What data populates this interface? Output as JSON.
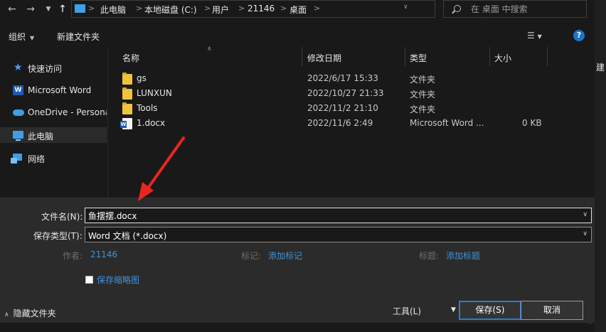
{
  "address": {
    "crumbs": [
      "此电脑",
      "本地磁盘 (C:)",
      "用户",
      "21146",
      "桌面"
    ],
    "search_placeholder": "在 桌面 中搜索"
  },
  "toolbar": {
    "organize": "组织",
    "new_folder": "新建文件夹",
    "help": "?"
  },
  "nav": {
    "items": [
      {
        "label": "快速访问",
        "icon": "star-icon"
      },
      {
        "label": "Microsoft Word",
        "icon": "word-icon"
      },
      {
        "label": "OneDrive - Persona",
        "icon": "cloud-icon"
      },
      {
        "label": "此电脑",
        "icon": "computer-icon",
        "selected": true
      },
      {
        "label": "网络",
        "icon": "network-icon"
      }
    ]
  },
  "files": {
    "columns": [
      "名称",
      "修改日期",
      "类型",
      "大小"
    ],
    "rows": [
      {
        "name": "gs",
        "date": "2022/6/17 15:33",
        "type": "文件夹",
        "size": "",
        "icon": "folder-icon"
      },
      {
        "name": "LUNXUN",
        "date": "2022/10/27 21:33",
        "type": "文件夹",
        "size": "",
        "icon": "folder-icon"
      },
      {
        "name": "Tools",
        "date": "2022/11/2 21:10",
        "type": "文件夹",
        "size": "",
        "icon": "folder-icon"
      },
      {
        "name": "1.docx",
        "date": "2022/11/6 2:49",
        "type": "Microsoft Word ...",
        "size": "0 KB",
        "icon": "word-doc-icon"
      }
    ]
  },
  "save": {
    "filename_label": "文件名(N):",
    "filename_value": "鱼摆摆.docx",
    "filetype_label": "保存类型(T):",
    "filetype_value": "Word 文档 (*.docx)",
    "author_label": "作者:",
    "author_value": "21146",
    "tags_label": "标记:",
    "tags_value": "添加标记",
    "title_label": "标题:",
    "title_value": "添加标题",
    "thumbnail_label": "保存缩略图",
    "hide_folders": "隐藏文件夹",
    "tools_label": "工具(L)",
    "save_button": "保存(S)",
    "cancel_button": "取消"
  },
  "peek_text": "建",
  "colors": {
    "accent": "#2d7bd1",
    "link": "#3f92dc",
    "folder": "#f0c33c",
    "arrow": "#e8261f"
  }
}
